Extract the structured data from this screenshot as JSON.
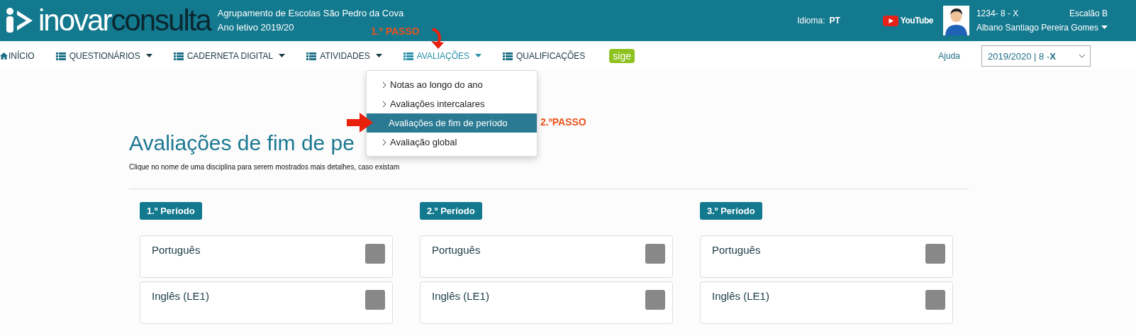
{
  "header": {
    "logo": {
      "light": "inovar",
      "dark": "consulta"
    },
    "school": "Agrupamento de Escolas São Pedro da Cova",
    "school_year": "Ano letivo 2019/20",
    "language_label": "Idioma:",
    "language": "PT",
    "youtube": "YouTube",
    "student_code": "1234- 8 - X",
    "tier": "Escalão B",
    "student_name": "Albano Santiago Pereira Gomes"
  },
  "nav": {
    "items": [
      {
        "label": "INÍCIO",
        "kind": "home",
        "dropdown": false,
        "selected": false
      },
      {
        "label": "QUESTIONÁRIOS",
        "kind": "menu",
        "dropdown": true,
        "selected": false
      },
      {
        "label": "CADERNETA DIGITAL",
        "kind": "menu",
        "dropdown": true,
        "selected": false
      },
      {
        "label": "ATIVIDADES",
        "kind": "menu",
        "dropdown": true,
        "selected": false
      },
      {
        "label": "AVALIAÇÕES",
        "kind": "menu",
        "dropdown": true,
        "selected": true
      },
      {
        "label": "QUALIFICAÇÕES",
        "kind": "menu",
        "dropdown": false,
        "selected": false
      }
    ],
    "badge": "sige",
    "help": "Ajuda",
    "year_select": "2019/2020 | 8 -**X**"
  },
  "dropdown_menu": [
    {
      "label": "Notas ao longo do ano",
      "selected": false
    },
    {
      "label": "Avaliações intercalares",
      "selected": false
    },
    {
      "label": "Avaliações de fim de período",
      "selected": true
    },
    {
      "label": "Avaliação global",
      "selected": false
    }
  ],
  "annotations": [
    {
      "text": "1.º PASSO"
    },
    {
      "text": "2.ºPASSO"
    }
  ],
  "page": {
    "title": "Avaliações de fim de pe",
    "hint": "Clique no nome de uma disciplina para serem mostrados mais detalhes, caso existam",
    "periods": [
      {
        "label": "1.º Período",
        "subjects": [
          {
            "name": "Português"
          },
          {
            "name": "Inglês (LE1)"
          }
        ]
      },
      {
        "label": "2.º Período",
        "subjects": [
          {
            "name": "Português"
          },
          {
            "name": "Inglês (LE1)"
          }
        ]
      },
      {
        "label": "3.º Período",
        "subjects": [
          {
            "name": "Português"
          },
          {
            "name": "Inglês (LE1)"
          }
        ]
      }
    ]
  }
}
